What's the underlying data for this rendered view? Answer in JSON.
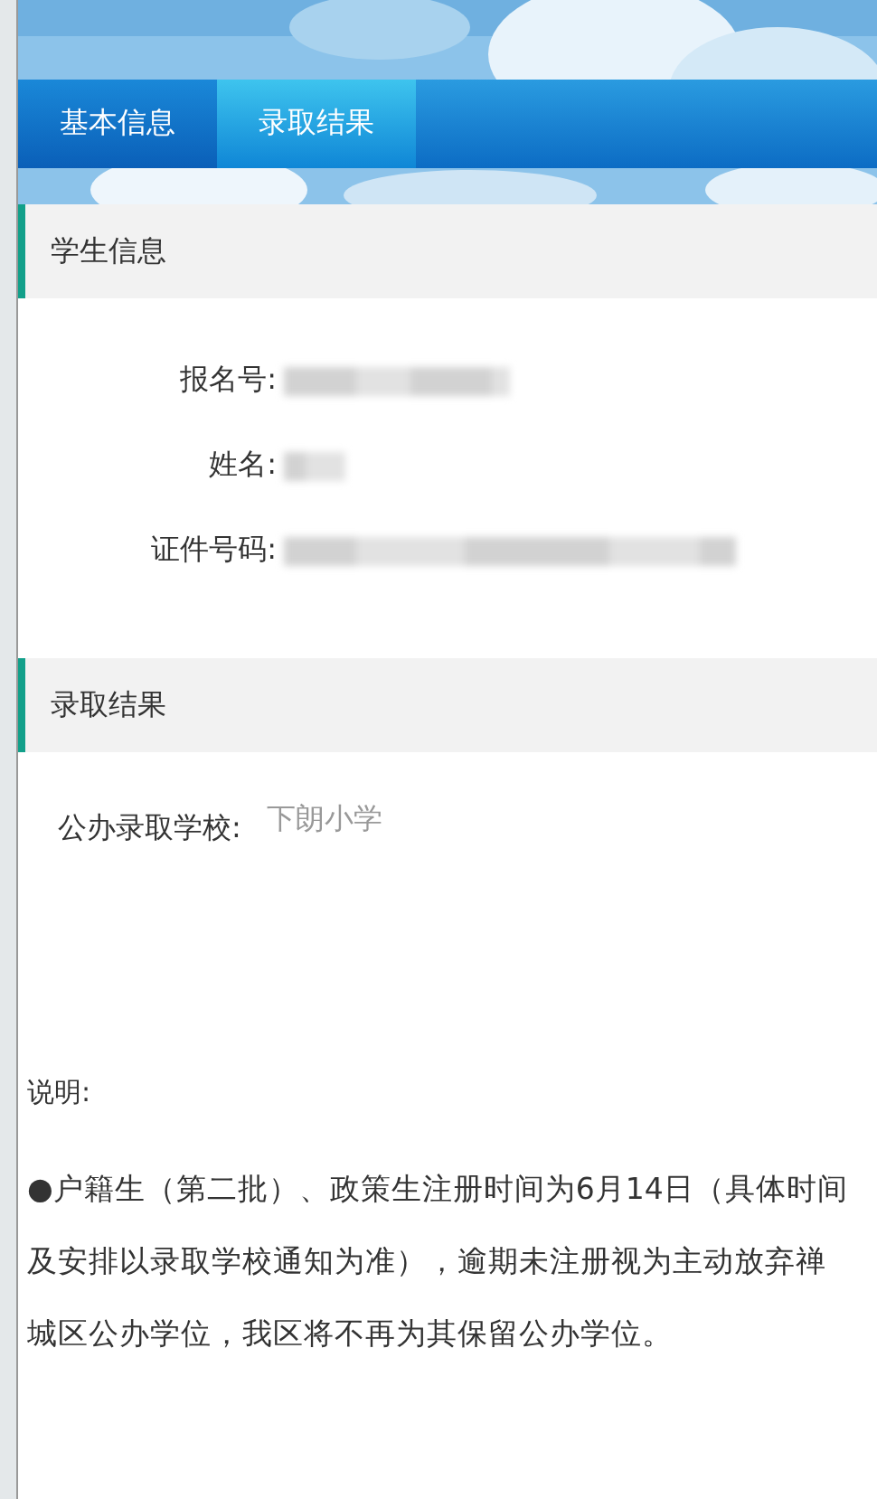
{
  "tabs": [
    {
      "label": "基本信息",
      "selected": false
    },
    {
      "label": "录取结果",
      "selected": true
    }
  ],
  "student_info": {
    "title": "学生信息",
    "fields": [
      {
        "label": "报名号:",
        "redacted": true
      },
      {
        "label": "姓名:",
        "redacted": true
      },
      {
        "label": "证件号码:",
        "redacted": true
      }
    ]
  },
  "admission_result": {
    "title": "录取结果",
    "school_label": "公办录取学校:",
    "school": "下朗小学",
    "note_title": "说明:",
    "note": "●户籍生（第二批）、政策生注册时间为6月14日（具体时间及安排以录取学校通知为准），逾期未注册视为主动放弃禅城区公办学位，我区将不再为其保留公办学位。"
  }
}
